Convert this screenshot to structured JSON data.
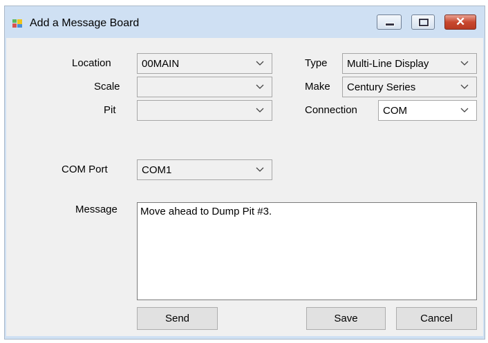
{
  "window": {
    "title": "Add a Message Board"
  },
  "fields": {
    "location": {
      "label": "Location",
      "value": "00MAIN"
    },
    "scale": {
      "label": "Scale",
      "value": ""
    },
    "pit": {
      "label": "Pit",
      "value": ""
    },
    "type": {
      "label": "Type",
      "value": "Multi-Line Display"
    },
    "make": {
      "label": "Make",
      "value": "Century Series"
    },
    "connection": {
      "label": "Connection",
      "value": "COM"
    },
    "com_port": {
      "label": "COM Port",
      "value": "COM1"
    },
    "message": {
      "label": "Message",
      "value": "Move ahead to Dump Pit #3."
    }
  },
  "buttons": {
    "send": "Send",
    "save": "Save",
    "cancel": "Cancel"
  },
  "colors": {
    "title_bar": "#cfe0f3",
    "client_bg": "#f0f0f0",
    "close_button": "#c8482f"
  }
}
